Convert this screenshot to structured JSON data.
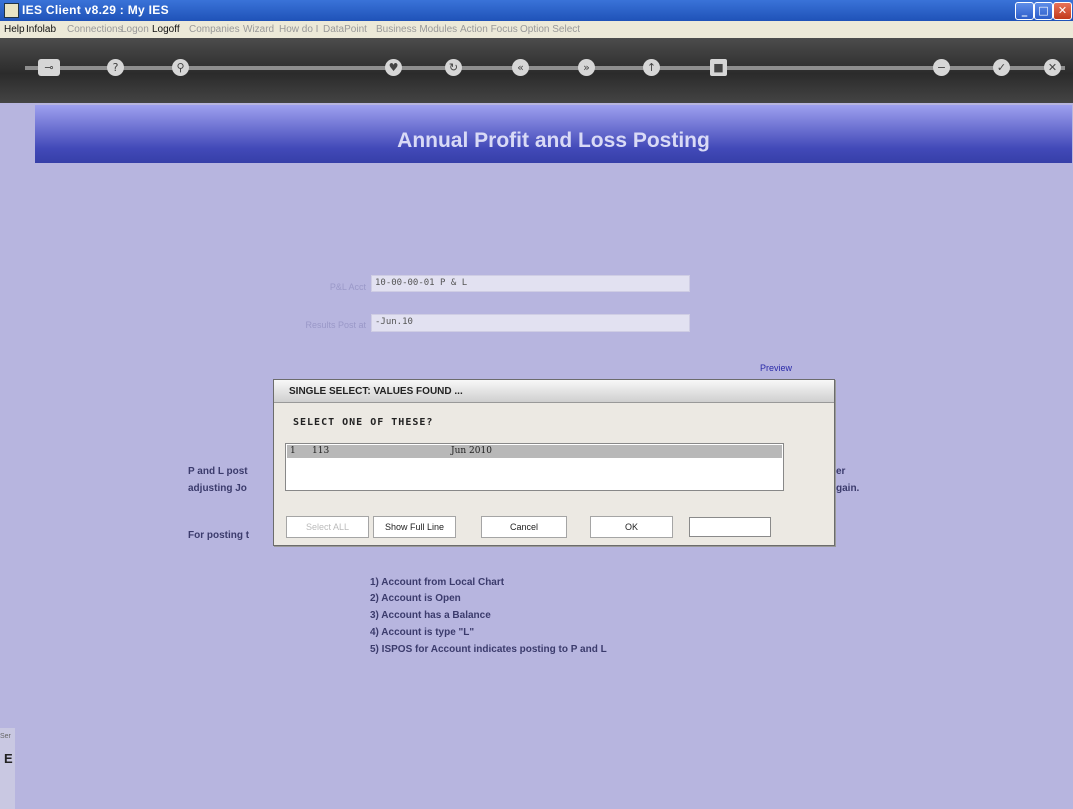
{
  "window": {
    "title": "IES Client v8.29 : My IES"
  },
  "menu": {
    "items": [
      "Help",
      "Infolab",
      "Connections",
      "Logon",
      "Logoff",
      "Companies",
      "Wizard",
      "How do I",
      "DataPoint",
      "Business Modules",
      "Action Focus",
      "Option Select"
    ],
    "enabled": [
      true,
      true,
      false,
      false,
      true,
      false,
      false,
      false,
      false,
      false,
      false,
      false
    ]
  },
  "toolbar": {
    "icons": [
      "key-icon",
      "help-icon",
      "search-icon",
      "heart-icon",
      "refresh-icon",
      "back-icon",
      "forward-icon",
      "up-icon",
      "stop-icon",
      "minus-icon",
      "check-icon",
      "close-icon"
    ]
  },
  "page": {
    "title": "Annual Profit and Loss Posting",
    "pl_acct_label": "P&L Acct",
    "pl_acct_value": "10-00-00-01 P & L",
    "results_label": "Results Post at",
    "results_value": "-Jun.10",
    "preview_label": "Preview",
    "para_line1": "P and L post",
    "para_line2": "adjusting Jo",
    "para_right1": "er",
    "para_right2": "gain.",
    "para_line3": "For posting t",
    "conditions": [
      "1) Account from Local Chart",
      "2) Account is Open",
      "3) Account has a Balance",
      "4) Account is type \"L\"",
      "5) ISPOS for Account indicates posting to P and L"
    ]
  },
  "dialog": {
    "title": "SINGLE SELECT: VALUES FOUND ...",
    "prompt": "SELECT ONE OF THESE?",
    "rows": [
      {
        "num": "1",
        "id": "113",
        "period": "Jun 2010"
      }
    ],
    "buttons": {
      "select_all": "Select ALL",
      "show_full_line": "Show Full Line",
      "cancel": "Cancel",
      "ok": "OK"
    }
  },
  "left_strip": {
    "dot": "Ser",
    "letter": "E"
  }
}
